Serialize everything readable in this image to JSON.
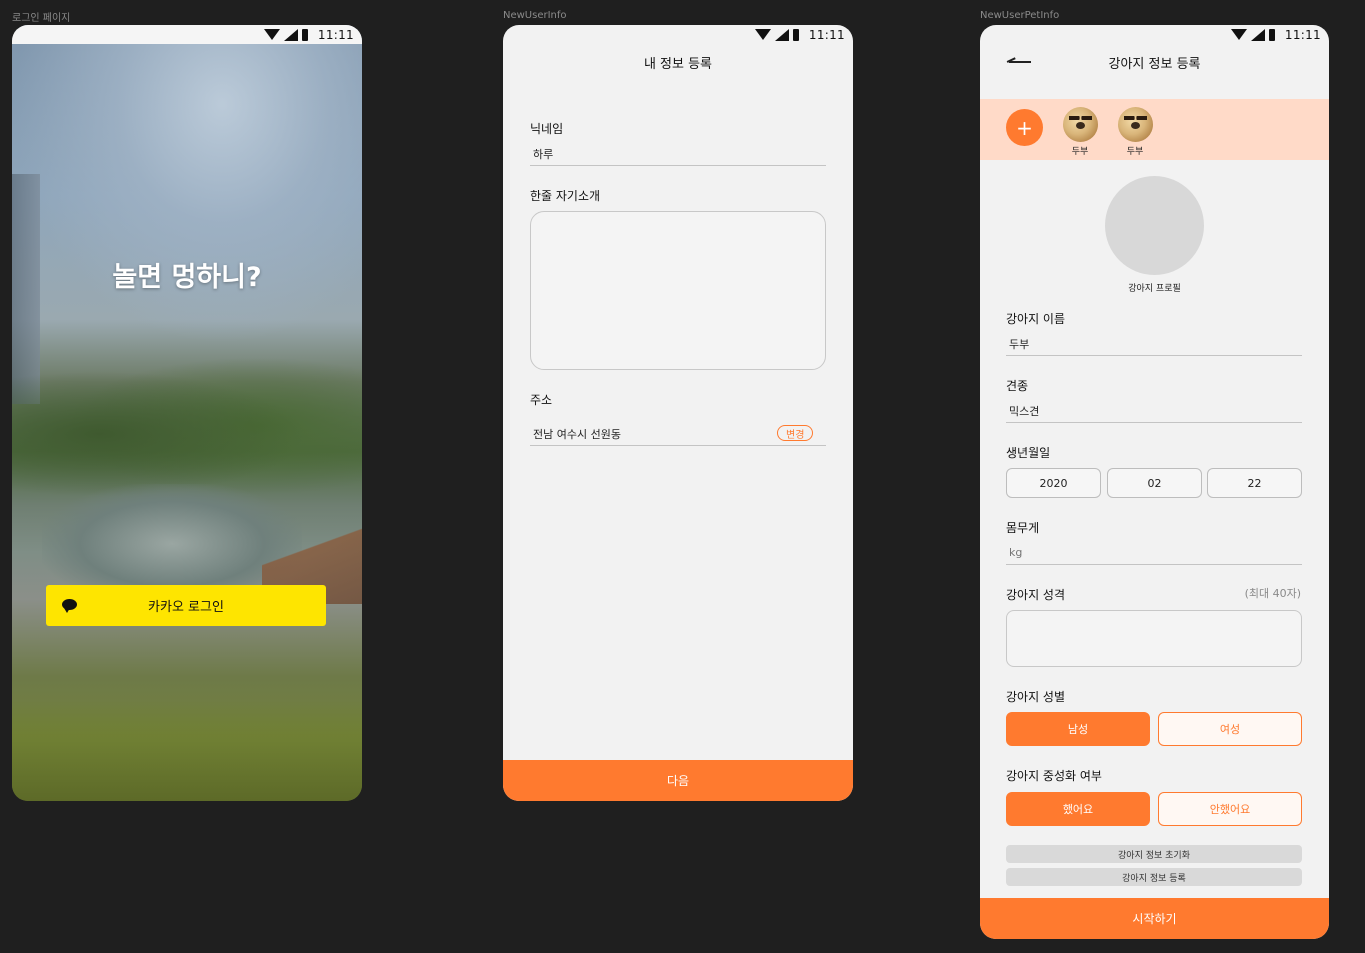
{
  "status_bar": {
    "time": "11:11"
  },
  "frames": {
    "login": "로그인 페이지",
    "new_user_info": "NewUserInfo",
    "new_user_pet_info": "NewUserPetInfo"
  },
  "login": {
    "headline": "놀면 멍하니?",
    "kakao_button": "카카오 로그인"
  },
  "user_info": {
    "title": "내 정보 등록",
    "nickname_label": "닉네임",
    "nickname_value": "하루",
    "bio_label": "한줄 자기소개",
    "address_label": "주소",
    "address_value": "전남 여수시 선원동",
    "change_button": "변경",
    "next_button": "다음"
  },
  "pet_info": {
    "title": "강아지 정보 등록",
    "add_icon": "+",
    "pets": [
      {
        "name": "두부"
      },
      {
        "name": "두부"
      }
    ],
    "profile_caption": "강아지 프로필",
    "name_label": "강아지 이름",
    "name_value": "두부",
    "breed_label": "견종",
    "breed_value": "믹스견",
    "birth_label": "생년월일",
    "birth": {
      "year": "2020",
      "month": "02",
      "day": "22"
    },
    "weight_label": "몸무게",
    "weight_placeholder": "kg",
    "personality_label": "강아지 성격",
    "personality_hint": "(최대 40자)",
    "gender_label": "강아지 성별",
    "gender_male": "남성",
    "gender_female": "여성",
    "neuter_label": "강아지 중성화 여부",
    "neuter_yes": "했어요",
    "neuter_no": "안했어요",
    "reset_button": "강아지 정보 초기화",
    "register_button": "강아지 정보 등록",
    "start_button": "시작하기"
  },
  "colors": {
    "accent": "#ff7a2f",
    "kakao": "#fee500",
    "pet_strip": "#ffdac8",
    "background": "#1f1f1f"
  }
}
